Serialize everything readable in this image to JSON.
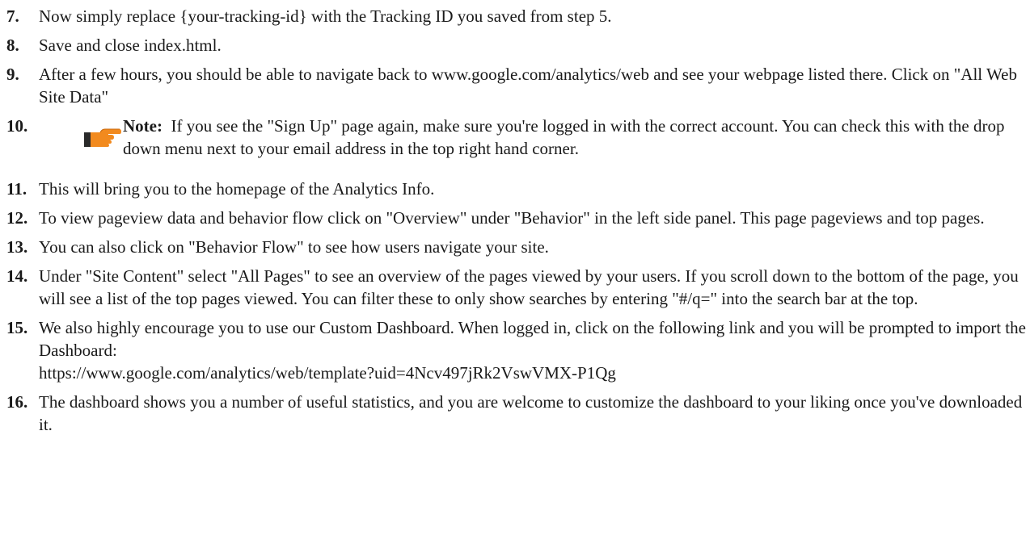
{
  "steps": [
    {
      "num": "7.",
      "text": "Now simply replace {your-tracking-id} with the Tracking ID you saved from step 5."
    },
    {
      "num": "8.",
      "text": "Save and close index.html."
    },
    {
      "num": "9.",
      "text": "After a few hours, you should be able to navigate back to www.google.com/analytics/web and see your webpage listed there. Click on \"All Web Site Data\""
    },
    {
      "num": "10.",
      "note_label": "Note:",
      "text": "If you see the \"Sign Up\" page again, make sure you're logged in with the correct account. You can check this with the drop down menu next to your email address in the top right hand corner.",
      "icon": "pointing-hand-icon"
    },
    {
      "num": "11.",
      "text": "This will bring you to the homepage of the Analytics Info."
    },
    {
      "num": "12.",
      "text": "To view pageview data and behavior flow click on \"Overview\" under \"Behavior\" in the left side panel. This page pageviews and top pages."
    },
    {
      "num": "13.",
      "text": "You can also click on \"Behavior Flow\" to see how users navigate your site."
    },
    {
      "num": "14.",
      "text": "Under \"Site Content\" select \"All Pages\" to see an overview of the pages viewed by your users. If you scroll down to the bottom of the page, you will see a list of the top pages viewed. You can filter these to only show searches by entering \"#/q=\" into the search bar at the top."
    },
    {
      "num": "15.",
      "text": "We also highly encourage you to use our Custom Dashboard. When logged in, click on the following link and you will be prompted to import the Dashboard:",
      "url": "https://www.google.com/analytics/web/template?uid=4Ncv497jRk2VswVMX-P1Qg"
    },
    {
      "num": "16.",
      "text": "The dashboard shows you a number of useful statistics, and you are welcome to customize the dashboard to your liking once you've downloaded it."
    }
  ],
  "colors": {
    "text": "#1a1a1a",
    "hand_orange": "#f28a1e",
    "hand_dark": "#2a2a2a"
  }
}
